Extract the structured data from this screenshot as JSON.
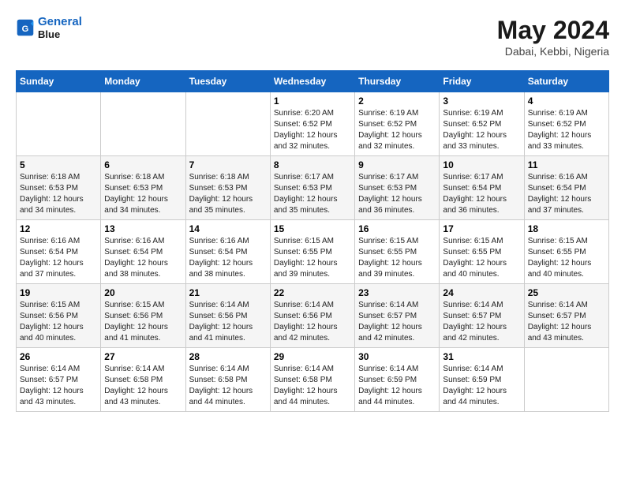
{
  "header": {
    "logo_line1": "General",
    "logo_line2": "Blue",
    "month_year": "May 2024",
    "location": "Dabai, Kebbi, Nigeria"
  },
  "weekdays": [
    "Sunday",
    "Monday",
    "Tuesday",
    "Wednesday",
    "Thursday",
    "Friday",
    "Saturday"
  ],
  "weeks": [
    [
      {
        "day": "",
        "sunrise": "",
        "sunset": "",
        "daylight": ""
      },
      {
        "day": "",
        "sunrise": "",
        "sunset": "",
        "daylight": ""
      },
      {
        "day": "",
        "sunrise": "",
        "sunset": "",
        "daylight": ""
      },
      {
        "day": "1",
        "sunrise": "Sunrise: 6:20 AM",
        "sunset": "Sunset: 6:52 PM",
        "daylight": "Daylight: 12 hours and 32 minutes."
      },
      {
        "day": "2",
        "sunrise": "Sunrise: 6:19 AM",
        "sunset": "Sunset: 6:52 PM",
        "daylight": "Daylight: 12 hours and 32 minutes."
      },
      {
        "day": "3",
        "sunrise": "Sunrise: 6:19 AM",
        "sunset": "Sunset: 6:52 PM",
        "daylight": "Daylight: 12 hours and 33 minutes."
      },
      {
        "day": "4",
        "sunrise": "Sunrise: 6:19 AM",
        "sunset": "Sunset: 6:52 PM",
        "daylight": "Daylight: 12 hours and 33 minutes."
      }
    ],
    [
      {
        "day": "5",
        "sunrise": "Sunrise: 6:18 AM",
        "sunset": "Sunset: 6:53 PM",
        "daylight": "Daylight: 12 hours and 34 minutes."
      },
      {
        "day": "6",
        "sunrise": "Sunrise: 6:18 AM",
        "sunset": "Sunset: 6:53 PM",
        "daylight": "Daylight: 12 hours and 34 minutes."
      },
      {
        "day": "7",
        "sunrise": "Sunrise: 6:18 AM",
        "sunset": "Sunset: 6:53 PM",
        "daylight": "Daylight: 12 hours and 35 minutes."
      },
      {
        "day": "8",
        "sunrise": "Sunrise: 6:17 AM",
        "sunset": "Sunset: 6:53 PM",
        "daylight": "Daylight: 12 hours and 35 minutes."
      },
      {
        "day": "9",
        "sunrise": "Sunrise: 6:17 AM",
        "sunset": "Sunset: 6:53 PM",
        "daylight": "Daylight: 12 hours and 36 minutes."
      },
      {
        "day": "10",
        "sunrise": "Sunrise: 6:17 AM",
        "sunset": "Sunset: 6:54 PM",
        "daylight": "Daylight: 12 hours and 36 minutes."
      },
      {
        "day": "11",
        "sunrise": "Sunrise: 6:16 AM",
        "sunset": "Sunset: 6:54 PM",
        "daylight": "Daylight: 12 hours and 37 minutes."
      }
    ],
    [
      {
        "day": "12",
        "sunrise": "Sunrise: 6:16 AM",
        "sunset": "Sunset: 6:54 PM",
        "daylight": "Daylight: 12 hours and 37 minutes."
      },
      {
        "day": "13",
        "sunrise": "Sunrise: 6:16 AM",
        "sunset": "Sunset: 6:54 PM",
        "daylight": "Daylight: 12 hours and 38 minutes."
      },
      {
        "day": "14",
        "sunrise": "Sunrise: 6:16 AM",
        "sunset": "Sunset: 6:54 PM",
        "daylight": "Daylight: 12 hours and 38 minutes."
      },
      {
        "day": "15",
        "sunrise": "Sunrise: 6:15 AM",
        "sunset": "Sunset: 6:55 PM",
        "daylight": "Daylight: 12 hours and 39 minutes."
      },
      {
        "day": "16",
        "sunrise": "Sunrise: 6:15 AM",
        "sunset": "Sunset: 6:55 PM",
        "daylight": "Daylight: 12 hours and 39 minutes."
      },
      {
        "day": "17",
        "sunrise": "Sunrise: 6:15 AM",
        "sunset": "Sunset: 6:55 PM",
        "daylight": "Daylight: 12 hours and 40 minutes."
      },
      {
        "day": "18",
        "sunrise": "Sunrise: 6:15 AM",
        "sunset": "Sunset: 6:55 PM",
        "daylight": "Daylight: 12 hours and 40 minutes."
      }
    ],
    [
      {
        "day": "19",
        "sunrise": "Sunrise: 6:15 AM",
        "sunset": "Sunset: 6:56 PM",
        "daylight": "Daylight: 12 hours and 40 minutes."
      },
      {
        "day": "20",
        "sunrise": "Sunrise: 6:15 AM",
        "sunset": "Sunset: 6:56 PM",
        "daylight": "Daylight: 12 hours and 41 minutes."
      },
      {
        "day": "21",
        "sunrise": "Sunrise: 6:14 AM",
        "sunset": "Sunset: 6:56 PM",
        "daylight": "Daylight: 12 hours and 41 minutes."
      },
      {
        "day": "22",
        "sunrise": "Sunrise: 6:14 AM",
        "sunset": "Sunset: 6:56 PM",
        "daylight": "Daylight: 12 hours and 42 minutes."
      },
      {
        "day": "23",
        "sunrise": "Sunrise: 6:14 AM",
        "sunset": "Sunset: 6:57 PM",
        "daylight": "Daylight: 12 hours and 42 minutes."
      },
      {
        "day": "24",
        "sunrise": "Sunrise: 6:14 AM",
        "sunset": "Sunset: 6:57 PM",
        "daylight": "Daylight: 12 hours and 42 minutes."
      },
      {
        "day": "25",
        "sunrise": "Sunrise: 6:14 AM",
        "sunset": "Sunset: 6:57 PM",
        "daylight": "Daylight: 12 hours and 43 minutes."
      }
    ],
    [
      {
        "day": "26",
        "sunrise": "Sunrise: 6:14 AM",
        "sunset": "Sunset: 6:57 PM",
        "daylight": "Daylight: 12 hours and 43 minutes."
      },
      {
        "day": "27",
        "sunrise": "Sunrise: 6:14 AM",
        "sunset": "Sunset: 6:58 PM",
        "daylight": "Daylight: 12 hours and 43 minutes."
      },
      {
        "day": "28",
        "sunrise": "Sunrise: 6:14 AM",
        "sunset": "Sunset: 6:58 PM",
        "daylight": "Daylight: 12 hours and 44 minutes."
      },
      {
        "day": "29",
        "sunrise": "Sunrise: 6:14 AM",
        "sunset": "Sunset: 6:58 PM",
        "daylight": "Daylight: 12 hours and 44 minutes."
      },
      {
        "day": "30",
        "sunrise": "Sunrise: 6:14 AM",
        "sunset": "Sunset: 6:59 PM",
        "daylight": "Daylight: 12 hours and 44 minutes."
      },
      {
        "day": "31",
        "sunrise": "Sunrise: 6:14 AM",
        "sunset": "Sunset: 6:59 PM",
        "daylight": "Daylight: 12 hours and 44 minutes."
      },
      {
        "day": "",
        "sunrise": "",
        "sunset": "",
        "daylight": ""
      }
    ]
  ]
}
